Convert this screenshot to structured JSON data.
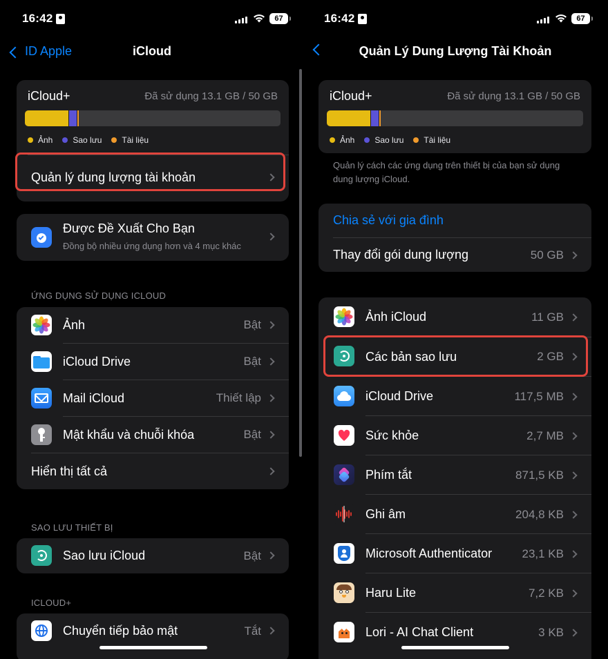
{
  "status_bar": {
    "time": "16:42",
    "battery": "67"
  },
  "colors": {
    "accent": "#0a84ff",
    "photos": "#e6bb12",
    "backups": "#5b53d6",
    "docs": "#f09a2c",
    "highlight": "#e0443c"
  },
  "left": {
    "nav": {
      "back_label": "ID Apple",
      "title": "iCloud"
    },
    "storage": {
      "title": "iCloud+",
      "used": "Đã sử dụng 13.1 GB / 50 GB",
      "segments": [
        {
          "name": "photos",
          "fraction": 0.17
        },
        {
          "name": "backups",
          "fraction": 0.032
        },
        {
          "name": "docs",
          "fraction": 0.008
        }
      ],
      "legend": [
        "Ảnh",
        "Sao lưu",
        "Tài liệu"
      ],
      "manage_label": "Quản lý dung lượng tài khoản"
    },
    "suggested": {
      "title": "Được Đề Xuất Cho Bạn",
      "subtitle": "Đồng bộ nhiều ứng dụng hơn và 4 mục khác",
      "icon": "suggestions-icon"
    },
    "apps_header": "ỨNG DỤNG SỬ DỤNG ICLOUD",
    "apps": [
      {
        "label": "Ảnh",
        "value": "Bật",
        "icon": "photos-icon"
      },
      {
        "label": "iCloud Drive",
        "value": "Bật",
        "icon": "folder-icon"
      },
      {
        "label": "Mail iCloud",
        "value": "Thiết lập",
        "icon": "mail-icon"
      },
      {
        "label": "Mật khẩu và chuỗi khóa",
        "value": "Bật",
        "icon": "key-icon"
      }
    ],
    "show_all": "Hiển thị tất cả",
    "backup_header": "SAO LƯU THIẾT BỊ",
    "backup": {
      "label": "Sao lưu iCloud",
      "value": "Bật",
      "icon": "backup-icon"
    },
    "icloudplus_header": "ICLOUD+",
    "relay": {
      "label": "Chuyển tiếp bảo mật",
      "value": "Tắt",
      "icon": "globe-icon"
    }
  },
  "right": {
    "nav": {
      "title": "Quản Lý Dung Lượng Tài Khoản"
    },
    "storage": {
      "title": "iCloud+",
      "used": "Đã sử dụng 13.1 GB / 50 GB",
      "legend": [
        "Ảnh",
        "Sao lưu",
        "Tài liệu"
      ]
    },
    "footnote": "Quản lý cách các ứng dụng trên thiết bị của bạn sử dụng dung lượng iCloud.",
    "family_share": "Chia sẻ với gia đình",
    "change_plan": {
      "label": "Thay đổi gói dung lượng",
      "value": "50 GB"
    },
    "apps": [
      {
        "label": "Ảnh iCloud",
        "value": "11 GB",
        "icon": "photos-icon"
      },
      {
        "label": "Các bản sao lưu",
        "value": "2 GB",
        "icon": "backup-icon"
      },
      {
        "label": "iCloud Drive",
        "value": "117,5 MB",
        "icon": "icloud-icon"
      },
      {
        "label": "Sức khỏe",
        "value": "2,7 MB",
        "icon": "health-icon"
      },
      {
        "label": "Phím tắt",
        "value": "871,5 KB",
        "icon": "shortcuts-icon"
      },
      {
        "label": "Ghi âm",
        "value": "204,8 KB",
        "icon": "voice-memos-icon"
      },
      {
        "label": "Microsoft Authenticator",
        "value": "23,1 KB",
        "icon": "authenticator-icon"
      },
      {
        "label": "Haru Lite",
        "value": "7,2 KB",
        "icon": "haru-icon"
      },
      {
        "label": "Lori - AI Chat Client",
        "value": "3 KB",
        "icon": "lori-icon"
      }
    ]
  }
}
